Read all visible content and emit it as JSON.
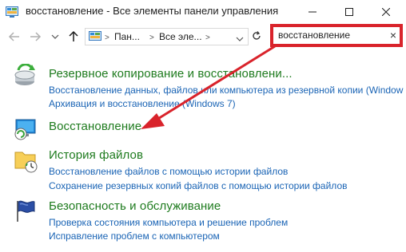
{
  "window": {
    "title": "восстановление - Все элементы панели управления",
    "icon": "control-panel-icon",
    "controls": [
      "minimize",
      "maximize",
      "close"
    ]
  },
  "navigation": {
    "back": "back-arrow",
    "forward": "forward-arrow",
    "recent": "recent-dropdown",
    "up": "up-arrow"
  },
  "address_bar": {
    "crumbs": [
      "Пан...",
      "Все элe..."
    ],
    "separator": ">",
    "refresh": "refresh-icon"
  },
  "search": {
    "value": "восстановление",
    "clear_label": "×"
  },
  "results": [
    {
      "heading": "Резервное копирование и восстановлени...",
      "icon": "backup-restore-icon",
      "links": [
        "Восстановление данных, файлов или компьютера из резервной копии (Window",
        "Архивация и восстановление (Windows 7)"
      ]
    },
    {
      "heading": "Восстановление",
      "icon": "recovery-icon",
      "links": []
    },
    {
      "heading": "История файлов",
      "icon": "file-history-icon",
      "links": [
        "Восстановление файлов с помощью истории файлов",
        "Сохранение резервных копий файлов с помощью истории файлов"
      ]
    },
    {
      "heading": "Безопасность и обслуживание",
      "icon": "security-flag-icon",
      "links": [
        "Проверка состояния компьютера и решение проблем",
        "Исправление проблем с компьютером"
      ]
    }
  ],
  "annotation": {
    "highlight_color": "#d9232b",
    "arrow_color": "#d9232b"
  }
}
